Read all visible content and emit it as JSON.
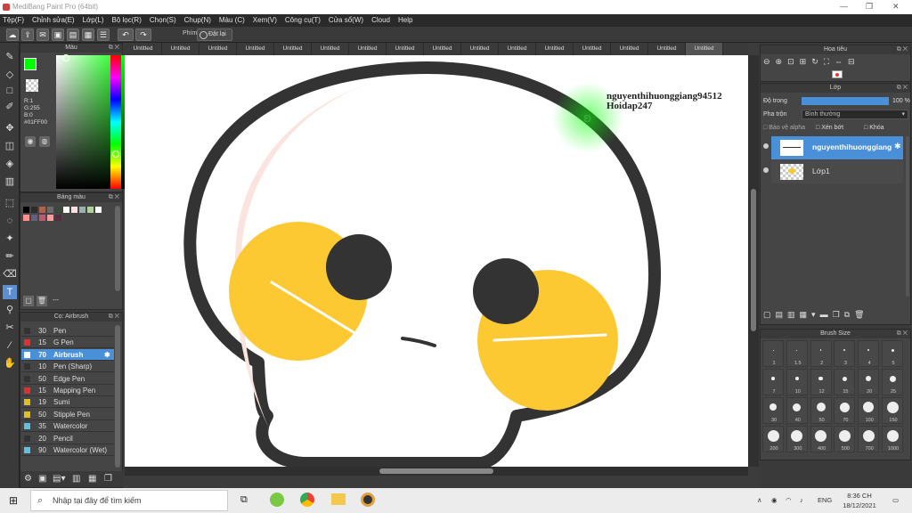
{
  "window": {
    "title": "MediBang Paint Pro (64bit)"
  },
  "menu": [
    "Tệp(F)",
    "Chỉnh sửa(E)",
    "Lớp(L)",
    "Bộ lọc(R)",
    "Chọn(S)",
    "Chụp(N)",
    "Màu (C)",
    "Xem(V)",
    "Công cụ(T)",
    "Cửa sổ(W)",
    "Cloud",
    "Help"
  ],
  "toolbar": {
    "phim": "Phím",
    "reset": "Đặt lại"
  },
  "tabs": [
    "Untitled",
    "Untitled",
    "Untitled",
    "Untitled",
    "Untitled",
    "Untitled",
    "Untitled",
    "Untitled",
    "Untitled",
    "Untitled",
    "Untitled",
    "Untitled",
    "Untitled",
    "Untitled",
    "Untitled",
    "Untitled"
  ],
  "color_panel": {
    "title": "Màu",
    "r": "R:1",
    "g": "G:255",
    "b": "B:0",
    "hex": "#01FF00",
    "fg": "#01ff00"
  },
  "palette_panel": {
    "title": "Bảng màu",
    "more": "---",
    "swatches": [
      "#000000",
      "#2c2c2c",
      "#b06050",
      "#6b6b6b",
      "#3a4a3a",
      "#ffffff",
      "#ffdede",
      "#9ab0b0",
      "#b0d0a0",
      "#ffffff",
      "#ff9090",
      "#606080",
      "#b06070",
      "#ff9999",
      "#503040"
    ]
  },
  "brush_panel": {
    "title": "Cọ: Airbrush",
    "brushes": [
      {
        "size": "30",
        "name": "Pen",
        "color": "#333333"
      },
      {
        "size": "15",
        "name": "G Pen",
        "color": "#e03030"
      },
      {
        "size": "70",
        "name": "Airbrush",
        "color": "#ffffff"
      },
      {
        "size": "10",
        "name": "Pen (Sharp)",
        "color": "#333333"
      },
      {
        "size": "50",
        "name": "Edge Pen",
        "color": "#333333"
      },
      {
        "size": "15",
        "name": "Mapping Pen",
        "color": "#e03030"
      },
      {
        "size": "19",
        "name": "Sumi",
        "color": "#e0c020"
      },
      {
        "size": "50",
        "name": "Stipple Pen",
        "color": "#e0c020"
      },
      {
        "size": "35",
        "name": "Watercolor",
        "color": "#60c0e0"
      },
      {
        "size": "20",
        "name": "Pencil",
        "color": "#333333"
      },
      {
        "size": "90",
        "name": "Watercolor (Wet)",
        "color": "#60c0e0"
      }
    ]
  },
  "canvas": {
    "watermark_line1": "nguyenthihuonggiang94512",
    "watermark_line2": "Hoidap247"
  },
  "navigator": {
    "title": "Hoa tiêu"
  },
  "layer_panel": {
    "title": "Lớp",
    "opacity_label": "Độ trong",
    "opacity_value": "100 %",
    "opacity_fraction": 1.0,
    "blend_label": "Pha trộn",
    "blend_value": "Bình thường",
    "protect_alpha": "Bảo vệ alpha",
    "clipping": "Xén bớt",
    "lock": "Khóa",
    "layers": [
      {
        "name": "nguyenthihuonggiang"
      },
      {
        "name": "Lớp1"
      }
    ]
  },
  "brush_size_panel": {
    "title": "Brush Size",
    "sizes": [
      "1",
      "1.5",
      "2",
      "3",
      "4",
      "5",
      "7",
      "10",
      "12",
      "15",
      "20",
      "25",
      "30",
      "40",
      "50",
      "70",
      "100",
      "150",
      "200",
      "300",
      "400",
      "500",
      "700",
      "1000"
    ]
  },
  "taskbar": {
    "search_placeholder": "Nhập tại đây để tìm kiếm",
    "lang": "ENG",
    "time": "8:36 CH",
    "date": "18/12/2021"
  }
}
